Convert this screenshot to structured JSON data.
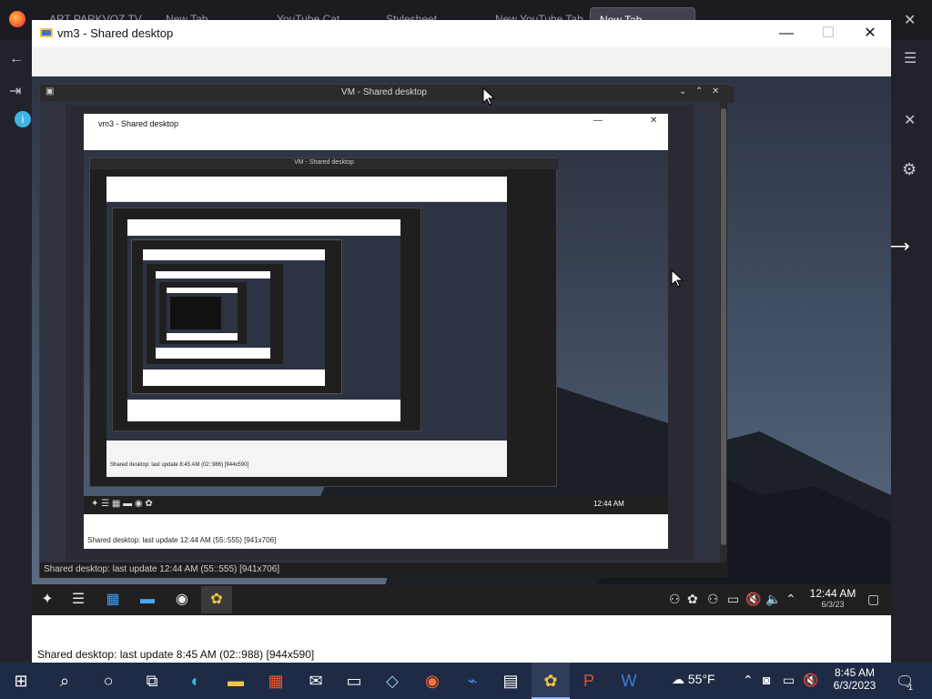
{
  "browser": {
    "tabs": [
      "ART PARKVOZ TV",
      "New Tab",
      "YouTube Cat",
      "Stylesheet",
      "New YouTube Tab",
      "New Tab"
    ],
    "sidebar_icons": [
      "back-icon",
      "signin-icon",
      "info-icon"
    ],
    "right_icons": [
      "menu-icon",
      "close-icon",
      "gear-icon"
    ]
  },
  "outer_window": {
    "title": "vm3 - Shared desktop",
    "minimize": "—",
    "maximize": "☐",
    "close": "✕",
    "status": "Shared desktop: last update 8:45 AM (02::988) [944x590]"
  },
  "vm_window": {
    "title": "VM - Shared desktop",
    "controls": [
      "⌄",
      "⌃",
      "✕"
    ],
    "status": "Shared desktop: last update 12:44 AM (55::555) [941x706]"
  },
  "nested": {
    "window_title": "vm3 - Shared desktop",
    "vm_title": "VM - Shared desktop",
    "status_1": "Shared desktop: last update 8:45 AM (02::986) [944x590]",
    "status_2": "Shared desktop: last update 12:44 AM (55::555) [941x706]",
    "time": "12:44 AM",
    "time2": "8:45 AM"
  },
  "remote_taskbar": {
    "apps": [
      "network-icon",
      "task-manager-icon",
      "store-icon",
      "file-explorer-icon",
      "chrome-icon",
      "remote-app-icon"
    ],
    "time": "12:44 AM",
    "date": "6/3/23"
  },
  "host_taskbar": {
    "weather": "55°F",
    "time": "8:45 AM",
    "date": "6/3/2023",
    "notifications": "1"
  }
}
